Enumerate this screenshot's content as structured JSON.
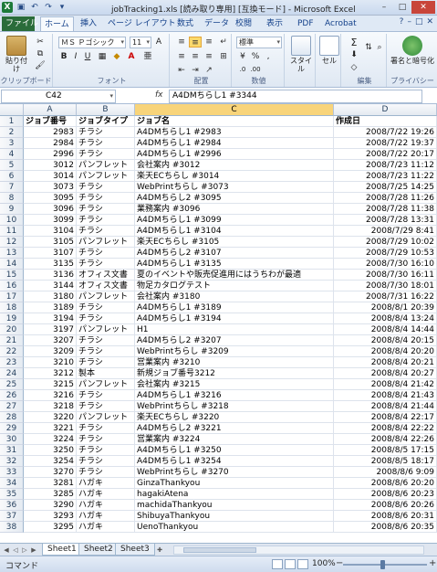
{
  "window": {
    "title": "jobTracking1.xls [読み取り専用] [互換モード] - Microsoft Excel",
    "min_glyph": "–",
    "max_glyph": "□",
    "close_glyph": "✕"
  },
  "qat_icons": [
    "excel-logo-icon",
    "save-icon",
    "undo-icon",
    "redo-icon",
    "customize-qat-icon"
  ],
  "ribbon_tabs": [
    "ファイル",
    "ホーム",
    "挿入",
    "ページ レイアウト",
    "数式",
    "データ",
    "校閲",
    "表示",
    "PDF",
    "Acrobat"
  ],
  "active_tab_index": 1,
  "ribbon": {
    "paste_label": "貼り付け",
    "clipboard_label": "クリップボード",
    "font_label": "フォント",
    "font_name": "ＭＳ Ｐゴシック",
    "font_size": "11",
    "alignment_label": "配置",
    "number_format": "標準",
    "number_label": "数値",
    "style_label": "スタイル",
    "cell_label": "セル",
    "edit_label": "編集",
    "privacy_label": "プライバシー",
    "share_label": "署名と暗号化"
  },
  "formula_bar": {
    "name_box": "C42",
    "fx": "fx",
    "value": "A4DMちらし1 #3344"
  },
  "columns": {
    "headers": [
      "A",
      "B",
      "C",
      "D"
    ],
    "selected": "C"
  },
  "table": {
    "header_row": {
      "a": "ジョブ番号",
      "b": "ジョブタイプ",
      "c": "ジョブ名",
      "d": "作成日"
    },
    "rows": [
      {
        "n": "2",
        "a": "2983",
        "b": "チラシ",
        "c": "A4DMちらし1 #2983",
        "d": "2008/7/22 19:26"
      },
      {
        "n": "3",
        "a": "2984",
        "b": "チラシ",
        "c": "A4DMちらし1 #2984",
        "d": "2008/7/22 19:37"
      },
      {
        "n": "4",
        "a": "2996",
        "b": "チラシ",
        "c": "A4DMちらし1 #2996",
        "d": "2008/7/22 20:17"
      },
      {
        "n": "5",
        "a": "3012",
        "b": "パンフレット",
        "c": "会社案内 #3012",
        "d": "2008/7/23 11:12"
      },
      {
        "n": "6",
        "a": "3014",
        "b": "パンフレット",
        "c": "楽天ECちらし #3014",
        "d": "2008/7/23 11:22"
      },
      {
        "n": "7",
        "a": "3073",
        "b": "チラシ",
        "c": "WebPrintちらし #3073",
        "d": "2008/7/25 14:25"
      },
      {
        "n": "8",
        "a": "3095",
        "b": "チラシ",
        "c": "A4DMちらし2 #3095",
        "d": "2008/7/28 11:26"
      },
      {
        "n": "9",
        "a": "3096",
        "b": "チラシ",
        "c": "業務案内 #3096",
        "d": "2008/7/28 11:38"
      },
      {
        "n": "10",
        "a": "3099",
        "b": "チラシ",
        "c": "A4DMちらし1 #3099",
        "d": "2008/7/28 13:31"
      },
      {
        "n": "11",
        "a": "3104",
        "b": "チラシ",
        "c": "A4DMちらし1 #3104",
        "d": "2008/7/29 8:41"
      },
      {
        "n": "12",
        "a": "3105",
        "b": "パンフレット",
        "c": "楽天ECちらし #3105",
        "d": "2008/7/29 10:02"
      },
      {
        "n": "13",
        "a": "3107",
        "b": "チラシ",
        "c": "A4DMちらし2 #3107",
        "d": "2008/7/29 10:53"
      },
      {
        "n": "14",
        "a": "3135",
        "b": "チラシ",
        "c": "A4DMちらし1 #3135",
        "d": "2008/7/30 16:10"
      },
      {
        "n": "15",
        "a": "3136",
        "b": "オフィス文書",
        "c": "夏のイベントや販売促進用にはうちわが最適",
        "d": "2008/7/30 16:11"
      },
      {
        "n": "16",
        "a": "3144",
        "b": "オフィス文書",
        "c": "物足カタログテスト",
        "d": "2008/7/30 18:01"
      },
      {
        "n": "17",
        "a": "3180",
        "b": "パンフレット",
        "c": "会社案内 #3180",
        "d": "2008/7/31 16:22"
      },
      {
        "n": "18",
        "a": "3189",
        "b": "チラシ",
        "c": "A4DMちらし1 #3189",
        "d": "2008/8/1 20:39"
      },
      {
        "n": "19",
        "a": "3194",
        "b": "チラシ",
        "c": "A4DMちらし1 #3194",
        "d": "2008/8/4 13:24"
      },
      {
        "n": "20",
        "a": "3197",
        "b": "パンフレット",
        "c": "H1",
        "d": "2008/8/4 14:44"
      },
      {
        "n": "21",
        "a": "3207",
        "b": "チラシ",
        "c": "A4DMちらし2 #3207",
        "d": "2008/8/4 20:15"
      },
      {
        "n": "22",
        "a": "3209",
        "b": "チラシ",
        "c": "WebPrintちらし #3209",
        "d": "2008/8/4 20:20"
      },
      {
        "n": "23",
        "a": "3210",
        "b": "チラシ",
        "c": "営業案内 #3210",
        "d": "2008/8/4 20:21"
      },
      {
        "n": "24",
        "a": "3212",
        "b": "製本",
        "c": "新規ジョブ番号3212",
        "d": "2008/8/4 20:27"
      },
      {
        "n": "25",
        "a": "3215",
        "b": "パンフレット",
        "c": "会社案内 #3215",
        "d": "2008/8/4 21:42"
      },
      {
        "n": "26",
        "a": "3216",
        "b": "チラシ",
        "c": "A4DMちらし1 #3216",
        "d": "2008/8/4 21:43"
      },
      {
        "n": "27",
        "a": "3218",
        "b": "チラシ",
        "c": "WebPrintちらし #3218",
        "d": "2008/8/4 21:44"
      },
      {
        "n": "28",
        "a": "3220",
        "b": "パンフレット",
        "c": "楽天ECちらし #3220",
        "d": "2008/8/4 22:17"
      },
      {
        "n": "29",
        "a": "3221",
        "b": "チラシ",
        "c": "A4DMちらし2 #3221",
        "d": "2008/8/4 22:22"
      },
      {
        "n": "30",
        "a": "3224",
        "b": "チラシ",
        "c": "営業案内 #3224",
        "d": "2008/8/4 22:26"
      },
      {
        "n": "31",
        "a": "3250",
        "b": "チラシ",
        "c": "A4DMちらし1 #3250",
        "d": "2008/8/5 17:15"
      },
      {
        "n": "32",
        "a": "3254",
        "b": "チラシ",
        "c": "A4DMちらし1 #3254",
        "d": "2008/8/5 18:17"
      },
      {
        "n": "33",
        "a": "3270",
        "b": "チラシ",
        "c": "WebPrintちらし #3270",
        "d": "2008/8/6 9:09"
      },
      {
        "n": "34",
        "a": "3281",
        "b": "ハガキ",
        "c": "GinzaThankyou",
        "d": "2008/8/6 20:20"
      },
      {
        "n": "35",
        "a": "3285",
        "b": "ハガキ",
        "c": "hagakiAtena",
        "d": "2008/8/6 20:23"
      },
      {
        "n": "36",
        "a": "3290",
        "b": "ハガキ",
        "c": "machidaThankyou",
        "d": "2008/8/6 20:26"
      },
      {
        "n": "37",
        "a": "3293",
        "b": "ハガキ",
        "c": "ShibuyaThankyou",
        "d": "2008/8/6 20:31"
      },
      {
        "n": "38",
        "a": "3295",
        "b": "ハガキ",
        "c": "UenoThankyou",
        "d": "2008/8/6 20:35"
      }
    ]
  },
  "sheet_tabs": [
    "Sheet1",
    "Sheet2",
    "Sheet3"
  ],
  "active_sheet": 0,
  "status": {
    "mode": "コマンド",
    "zoom": "100%"
  }
}
